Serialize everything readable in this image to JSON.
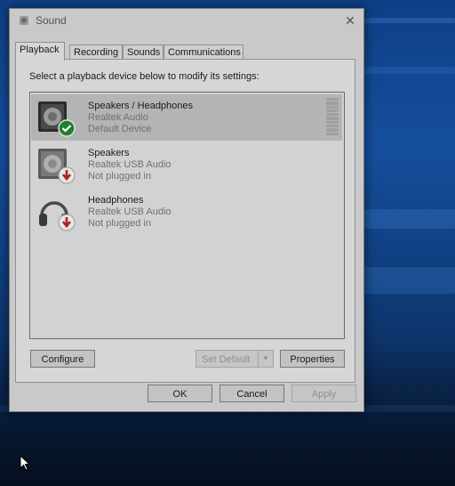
{
  "dialog": {
    "title": "Sound",
    "close_glyph": "✕"
  },
  "tabs": [
    {
      "label": "Playback",
      "active": true
    },
    {
      "label": "Recording"
    },
    {
      "label": "Sounds"
    },
    {
      "label": "Communications"
    }
  ],
  "playback": {
    "instruction": "Select a playback device below to modify its settings:",
    "devices": [
      {
        "name": "Speakers / Headphones",
        "driver": "Realtek Audio",
        "status": "Default Device",
        "icon": "speaker-icon",
        "badge": "check-icon",
        "selected": true
      },
      {
        "name": "Speakers",
        "driver": "Realtek USB Audio",
        "status": "Not plugged in",
        "icon": "speaker-icon",
        "badge": "down-arrow-icon"
      },
      {
        "name": "Headphones",
        "driver": "Realtek USB Audio",
        "status": "Not plugged in",
        "icon": "headphones-icon",
        "badge": "down-arrow-icon"
      }
    ],
    "buttons": {
      "configure": "Configure",
      "set_default": "Set Default",
      "properties": "Properties"
    }
  },
  "footer": {
    "ok": "OK",
    "cancel": "Cancel",
    "apply": "Apply"
  },
  "colors": {
    "check_badge": "#1f7f2a",
    "down_badge": "#b02020"
  }
}
